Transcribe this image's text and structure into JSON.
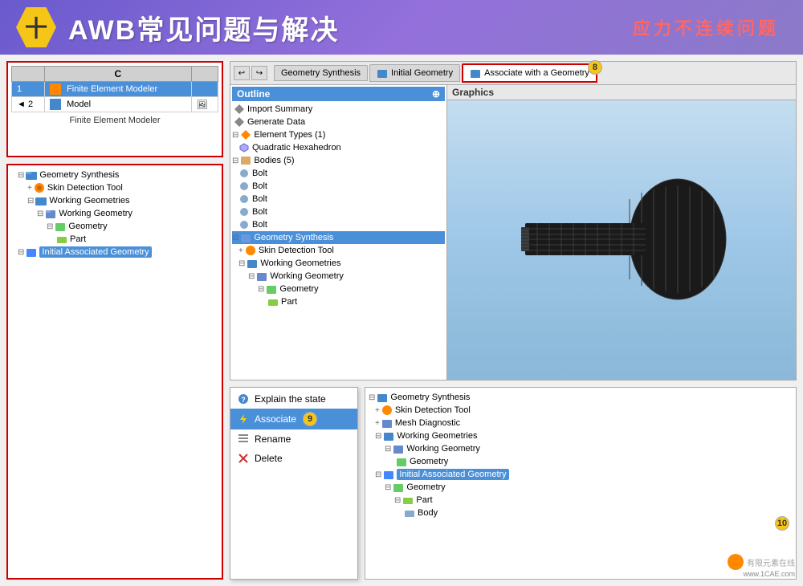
{
  "header": {
    "icon_text": "十",
    "title": "AWB常见问题与解决",
    "subtitle": "应力不连续问题"
  },
  "fem_panel": {
    "column_header": "C",
    "row1_num": "1",
    "row1_icon": "FE",
    "row1_label": "Finite Element Modeler",
    "row2_num": "2",
    "row2_label": "Model",
    "caption": "Finite Element Modeler"
  },
  "left_tree": {
    "items": [
      {
        "indent": 1,
        "label": "Geometry Synthesis",
        "icon": "folder",
        "expand": "⊟"
      },
      {
        "indent": 2,
        "label": "Skin Detection Tool",
        "icon": "gear",
        "expand": "+"
      },
      {
        "indent": 2,
        "label": "Working Geometries",
        "icon": "folder",
        "expand": "⊟"
      },
      {
        "indent": 3,
        "label": "Working Geometry",
        "icon": "mesh",
        "expand": "⊟"
      },
      {
        "indent": 4,
        "label": "Geometry",
        "icon": "green",
        "expand": "⊟"
      },
      {
        "indent": 5,
        "label": "Part",
        "icon": "green",
        "expand": ""
      },
      {
        "indent": 2,
        "label": "Initial Associated Geometry",
        "icon": "blue-box",
        "selected": true
      }
    ]
  },
  "tabs": {
    "undo_label": "↩",
    "redo_label": "↪",
    "tab1_label": "Geometry Synthesis",
    "tab2_label": "Initial Geometry",
    "tab3_label": "Associate with a Geometry",
    "badge_tab3": "8"
  },
  "outline": {
    "header": "Outline",
    "items": [
      {
        "indent": 0,
        "label": "Import Summary"
      },
      {
        "indent": 0,
        "label": "Generate Data"
      },
      {
        "indent": 0,
        "label": "Element Types (1)",
        "expand": "⊟"
      },
      {
        "indent": 1,
        "label": "Quadratic Hexahedron"
      },
      {
        "indent": 0,
        "label": "Bodies (5)",
        "expand": "⊟"
      },
      {
        "indent": 1,
        "label": "Bolt"
      },
      {
        "indent": 1,
        "label": "Bolt"
      },
      {
        "indent": 1,
        "label": "Bolt"
      },
      {
        "indent": 1,
        "label": "Bolt"
      },
      {
        "indent": 1,
        "label": "Bolt"
      },
      {
        "indent": 0,
        "label": "Geometry Synthesis",
        "selected": true,
        "expand": "⊟"
      },
      {
        "indent": 1,
        "label": "Skin Detection Tool"
      },
      {
        "indent": 1,
        "label": "Working Geometries",
        "expand": "⊟"
      },
      {
        "indent": 2,
        "label": "Working Geometry",
        "expand": "⊟"
      },
      {
        "indent": 3,
        "label": "Geometry",
        "expand": "⊟"
      },
      {
        "indent": 4,
        "label": "Part"
      }
    ]
  },
  "graphics": {
    "label": "Graphics"
  },
  "context_menu": {
    "header": "",
    "items": [
      {
        "label": "Explain the state",
        "icon": "question"
      },
      {
        "label": "Associate",
        "icon": "lightning",
        "selected": true
      },
      {
        "label": "Rename",
        "icon": "rename"
      },
      {
        "label": "Delete",
        "icon": "x"
      }
    ],
    "badge": "9"
  },
  "bottom_tree": {
    "items": [
      {
        "indent": 0,
        "label": "Geometry Synthesis",
        "expand": "⊟"
      },
      {
        "indent": 1,
        "label": "Skin Detection Tool"
      },
      {
        "indent": 1,
        "label": "Mesh Diagnostic"
      },
      {
        "indent": 1,
        "label": "Working Geometries",
        "expand": "⊟"
      },
      {
        "indent": 2,
        "label": "Working Geometry",
        "expand": "⊟"
      },
      {
        "indent": 3,
        "label": "Geometry"
      },
      {
        "indent": 1,
        "label": "Initial Associated Geometry",
        "selected": true,
        "expand": "⊟"
      },
      {
        "indent": 2,
        "label": "Geometry",
        "expand": "⊟"
      },
      {
        "indent": 3,
        "label": "Part",
        "expand": "⊟"
      },
      {
        "indent": 4,
        "label": "Body"
      }
    ],
    "badge": "10"
  },
  "watermark": {
    "url": "www.1CAE.com",
    "logo_text": "有限元素在线"
  }
}
